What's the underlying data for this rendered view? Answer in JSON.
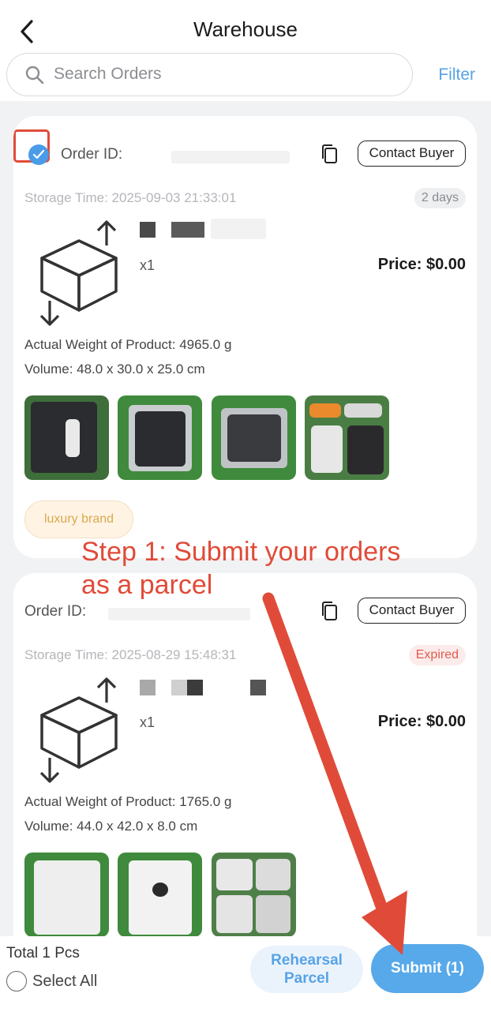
{
  "header": {
    "title": "Warehouse",
    "search_placeholder": "Search Orders",
    "filter_label": "Filter"
  },
  "orders": [
    {
      "order_id_label": "Order ID:",
      "contact_label": "Contact Buyer",
      "storage_time": "Storage Time: 2025-09-03 21:33:01",
      "status_badge": "2 days",
      "quantity": "x1",
      "price": "Price: $0.00",
      "weight": "Actual Weight of Product: 4965.0 g",
      "volume": "Volume: 48.0 x 30.0 x 25.0 cm",
      "tag": "luxury brand",
      "selected": true
    },
    {
      "order_id_label": "Order ID:",
      "contact_label": "Contact Buyer",
      "storage_time": "Storage Time: 2025-08-29 15:48:31",
      "status_badge": "Expired",
      "quantity": "x1",
      "price": "Price: $0.00",
      "weight": "Actual Weight of Product: 1765.0 g",
      "volume": "Volume: 44.0 x 42.0 x 8.0 cm",
      "selected": false
    }
  ],
  "annotation": {
    "line1": "Step 1: Submit your orders",
    "line2": "as a parcel"
  },
  "footer": {
    "total": "Total 1 Pcs",
    "select_all": "Select All",
    "rehearsal_line1": "Rehearsal",
    "rehearsal_line2": "Parcel",
    "submit": "Submit (1)"
  },
  "colors": {
    "accent": "#57a3e6",
    "annotation_red": "#e04b39",
    "expired_red": "#e25b4c"
  }
}
